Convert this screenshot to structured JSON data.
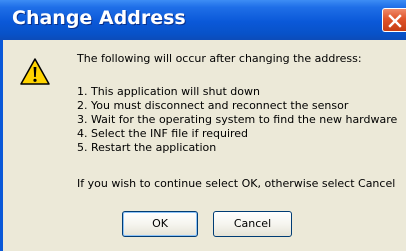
{
  "window": {
    "title": "Change Address"
  },
  "dialog": {
    "icon": "warning-icon",
    "intro": "The following will occur after changing the address:",
    "steps": [
      "1. This application will shut down",
      "2. You must disconnect and reconnect the sensor",
      "3. Wait for the operating system to find the new hardware",
      "4. Select the INF file if required",
      "5. Restart the application"
    ],
    "confirm": "If you wish to continue select OK, otherwise select Cancel"
  },
  "buttons": {
    "ok": "OK",
    "cancel": "Cancel"
  },
  "colors": {
    "titlebar": "#0a58d8",
    "close": "#e0542a",
    "warning": "#ffd400",
    "background": "#ece9d8"
  }
}
